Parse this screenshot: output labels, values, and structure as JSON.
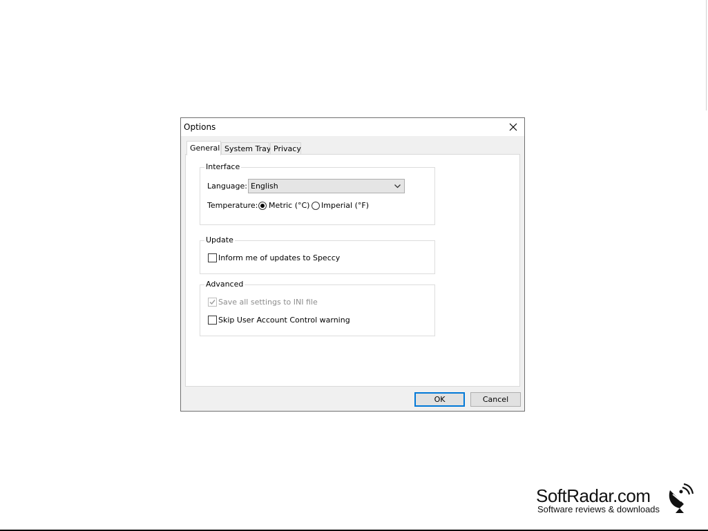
{
  "dialog": {
    "title": "Options",
    "tabs": [
      {
        "label": "General",
        "active": true
      },
      {
        "label": "System Tray",
        "active": false
      },
      {
        "label": "Privacy",
        "active": false
      }
    ],
    "interface": {
      "legend": "Interface",
      "language_label": "Language:",
      "language_value": "English",
      "temperature_label": "Temperature:",
      "temperature_options": [
        {
          "label": "Metric (°C)",
          "checked": true
        },
        {
          "label": "Imperial (°F)",
          "checked": false
        }
      ]
    },
    "update": {
      "legend": "Update",
      "inform_label": "Inform me of updates to Speccy",
      "inform_checked": false
    },
    "advanced": {
      "legend": "Advanced",
      "save_ini_label": "Save all settings to INI file",
      "save_ini_checked": true,
      "save_ini_disabled": true,
      "skip_uac_label": "Skip User Account Control warning",
      "skip_uac_checked": false
    },
    "buttons": {
      "ok": "OK",
      "cancel": "Cancel"
    }
  },
  "watermark": {
    "name": "SoftRadar.com",
    "tagline": "Software reviews & downloads"
  },
  "colors": {
    "accent": "#0078d7",
    "dialog_bg": "#f0f0f0",
    "disabled_text": "#8d8d8d"
  }
}
